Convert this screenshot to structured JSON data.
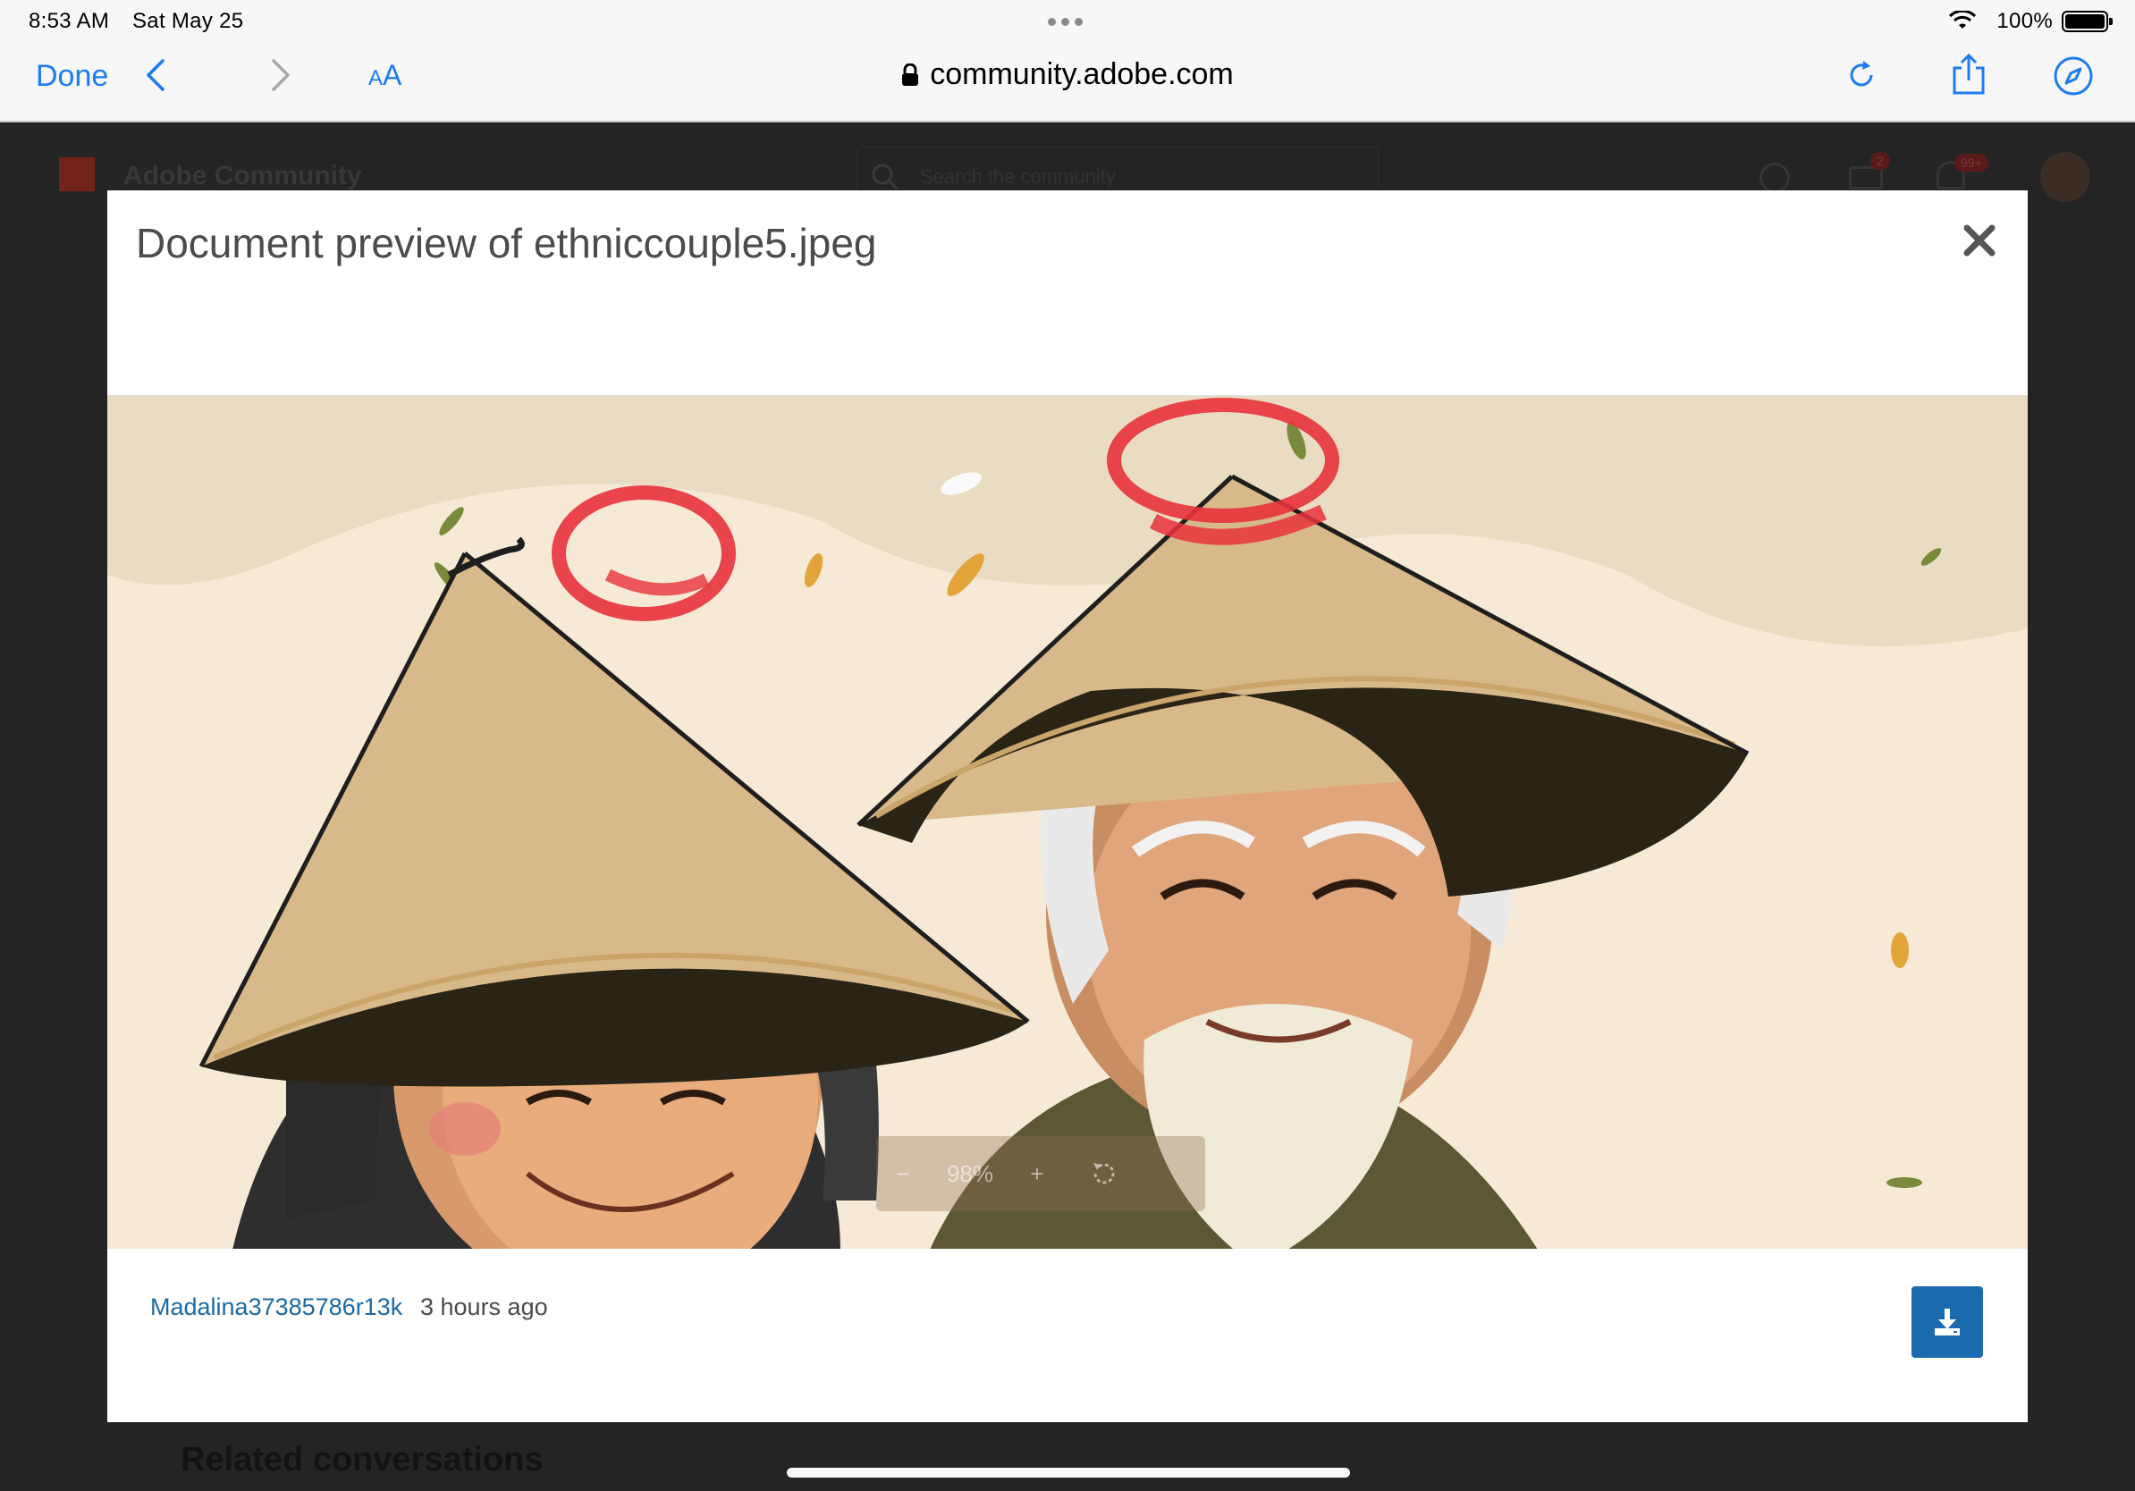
{
  "status_bar": {
    "time": "8:53 AM",
    "date": "Sat May 25",
    "battery": "100%"
  },
  "browser": {
    "done_label": "Done",
    "text_size_label_small": "A",
    "text_size_label_big": "A",
    "url": "community.adobe.com",
    "icons": [
      "back-icon",
      "forward-icon",
      "lock-icon",
      "reload-icon",
      "share-icon",
      "compass-icon"
    ]
  },
  "background_page": {
    "brand": "Adobe Community",
    "search_placeholder": "Search the community",
    "mail_badge": "2",
    "notif_badge": "99+",
    "related_heading": "Related conversations"
  },
  "modal": {
    "title": "Document preview of ethniccouple5.jpeg",
    "zoom": {
      "minus": "−",
      "value": "98%",
      "plus": "+"
    },
    "author": "Madalina37385786r13k",
    "time_ago": "3 hours ago",
    "colors": {
      "accent": "#1a6aad",
      "link": "#1a6aa6",
      "annotation": "#e8323c"
    }
  }
}
